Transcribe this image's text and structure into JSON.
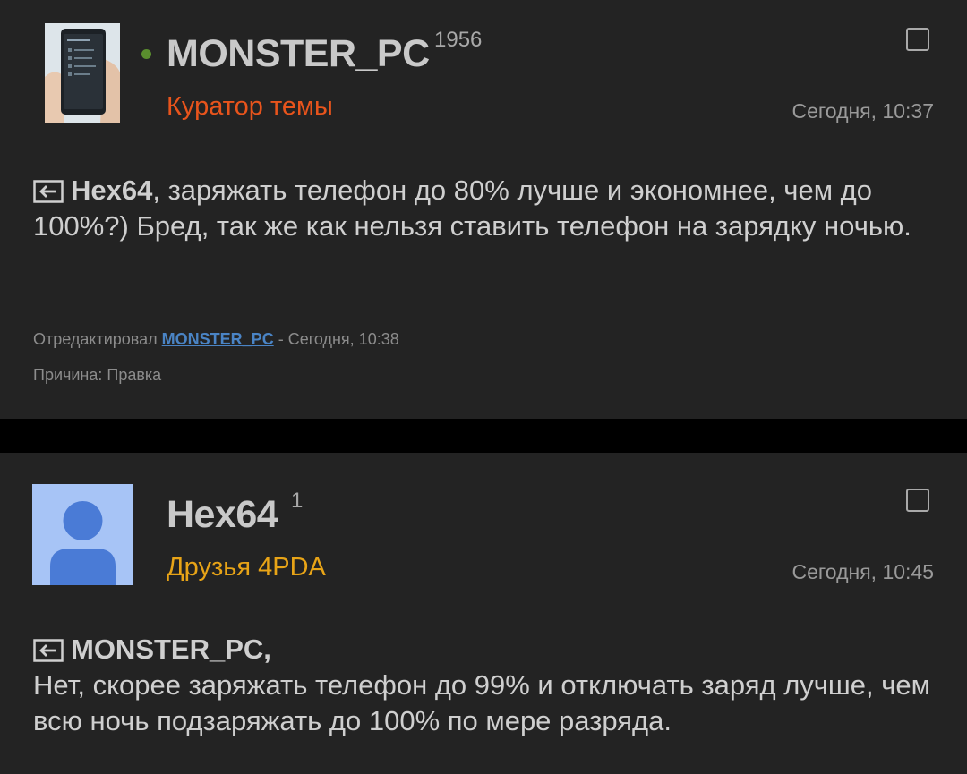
{
  "posts": [
    {
      "author": "MONSTER_PC",
      "reputation": "1956",
      "role": "Куратор темы",
      "role_color": "#e8541c",
      "time": "Сегодня, 10:37",
      "online": true,
      "quote_to": "Hex64",
      "text": ", заряжать телефон до 80% лучше и экономнее, чем до 100%?) Бред, так же как нельзя ставить телефон на зарядку ночью.",
      "edit": {
        "prefix": "Отредактировал",
        "editor": "MONSTER_PC",
        "suffix": "- Сегодня, 10:38",
        "reason": "Причина: Правка"
      }
    },
    {
      "author": "Hex64",
      "reputation": "1",
      "role": "Друзья 4PDA",
      "role_color": "#e8a417",
      "time": "Сегодня, 10:45",
      "online": false,
      "quote_to": "MONSTER_PC,",
      "text": "Нет, скорее заряжать телефон до 99% и отключать заряд лучше, чем всю ночь подзаряжать до 100% по мере разряда."
    }
  ],
  "icons": {
    "avatar_photo": "phone-photo-avatar",
    "avatar_default": "default-user-avatar-icon",
    "quote": "quote-arrow-icon",
    "select": "checkbox-icon",
    "online": "online-status-icon"
  }
}
